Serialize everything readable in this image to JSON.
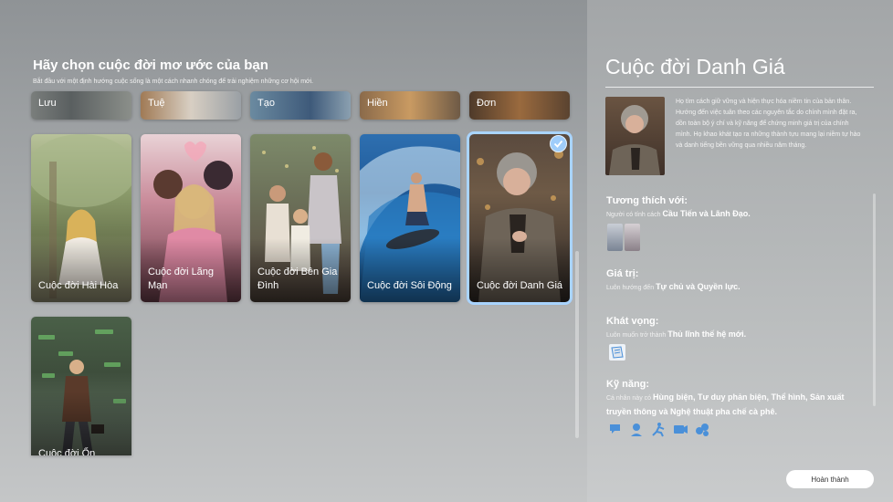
{
  "left": {
    "heading": "Hãy chọn cuộc đời mơ ước của bạn",
    "subheading": "Bắt đầu với một định hướng cuộc sống là một cách nhanh chóng để trải nghiệm những cơ hội mới.",
    "top_row": [
      "Lưu",
      "Tuệ",
      "Tạo",
      "Hiền",
      "Đơn"
    ],
    "cards": [
      {
        "label": "Cuộc đời Hài Hòa"
      },
      {
        "label": "Cuộc đời Lãng Mạn"
      },
      {
        "label": "Cuộc đời Bên Gia Đình"
      },
      {
        "label": "Cuộc đời Sôi Động"
      },
      {
        "label": "Cuộc đời Danh Giá",
        "selected": true
      },
      {
        "label": "Cuộc đời Ổn"
      }
    ]
  },
  "detail": {
    "title": "Cuộc đời Danh Giá",
    "description": "Họ tìm cách giữ vững và hiện thực hóa niềm tin của bản thân. Hướng đến việc tuân theo các nguyên tắc do chính mình đặt ra, dồn toàn bộ ý chí và kỹ năng để chứng minh giá trị của chính mình. Họ khao khát tạo ra những thành tựu mang lại niềm tự hào và danh tiếng bền vững qua nhiều năm tháng.",
    "compat": {
      "title": "Tương thích với:",
      "prefix": "Người có tính cách",
      "value": "Cầu Tiến và Lãnh Đạo."
    },
    "values": {
      "title": "Giá trị:",
      "prefix": "Luôn hướng đến",
      "value": "Tự chủ và Quyền lực."
    },
    "aspiration": {
      "title": "Khát vọng:",
      "prefix": "Luôn muốn trở thành",
      "value": "Thủ lĩnh thế hệ mới."
    },
    "skills": {
      "title": "Kỹ năng:",
      "prefix": "Cá nhân này có",
      "value": "Hùng biện, Tư duy phản biện, Thể hình, Sản xuất truyền thông và Nghệ thuật pha chế cà phê.",
      "icons": [
        "speech-icon",
        "thinking-icon",
        "fitness-icon",
        "media-icon",
        "coffee-icon"
      ]
    },
    "done_button": "Hoàn thành"
  },
  "colors": {
    "accent": "#a9d4ff",
    "skill_icon": "#4a90d9"
  }
}
